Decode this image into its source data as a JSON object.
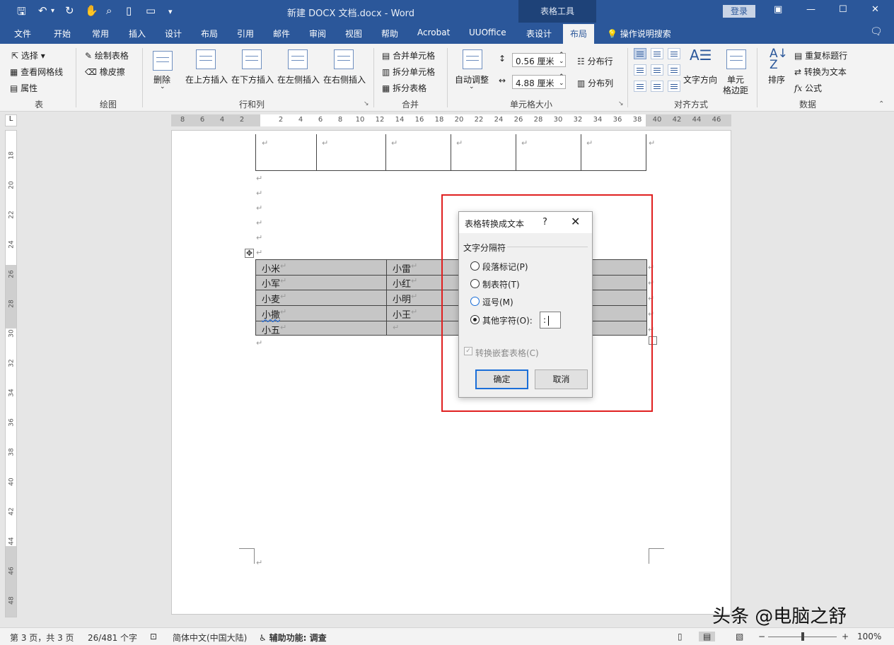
{
  "window": {
    "title": "新建 DOCX 文档.docx  -  Word",
    "context_tab_group": "表格工具",
    "login": "登录"
  },
  "tabs": [
    "文件",
    "开始",
    "常用",
    "插入",
    "设计",
    "布局",
    "引用",
    "邮件",
    "审阅",
    "视图",
    "帮助",
    "Acrobat",
    "UUOffice",
    "表设计",
    "布局"
  ],
  "active_tab_index": 14,
  "tell_me": "操作说明搜索",
  "ribbon": {
    "table": {
      "select": "选择",
      "view_gridlines": "查看网格线",
      "properties": "属性",
      "label": "表"
    },
    "draw": {
      "draw_table": "绘制表格",
      "eraser": "橡皮擦",
      "label": "绘图"
    },
    "rows_cols": {
      "delete": "删除",
      "insert_above": "在上方插入",
      "insert_below": "在下方插入",
      "insert_left": "在左侧插入",
      "insert_right": "在右侧插入",
      "label": "行和列"
    },
    "merge": {
      "merge_cells": "合并单元格",
      "split_cells": "拆分单元格",
      "split_table": "拆分表格",
      "label": "合并"
    },
    "cell_size": {
      "autofit": "自动调整",
      "height": "0.56 厘米",
      "width": "4.88 厘米",
      "dist_rows": "分布行",
      "dist_cols": "分布列",
      "label": "单元格大小"
    },
    "alignment": {
      "text_direction": "文字方向",
      "cell_margins_1": "单元",
      "cell_margins_2": "格边距",
      "label": "对齐方式"
    },
    "data": {
      "sort": "排序",
      "repeat_header": "重复标题行",
      "convert_to_text": "转换为文本",
      "formula": "公式",
      "label": "数据"
    }
  },
  "ruler": {
    "h_numbers": [
      "8",
      "6",
      "4",
      "2",
      "2",
      "4",
      "6",
      "8",
      "10",
      "12",
      "14",
      "16",
      "18",
      "20",
      "22",
      "24",
      "26",
      "28",
      "30",
      "32",
      "34",
      "36",
      "38",
      "40",
      "42",
      "44",
      "46"
    ],
    "v_numbers": [
      "18",
      "20",
      "22",
      "24",
      "26",
      "28",
      "30",
      "32",
      "34",
      "36",
      "38",
      "40",
      "42",
      "44",
      "46",
      "48"
    ],
    "corner": "L"
  },
  "document": {
    "selected_table": [
      [
        "小米",
        "小雷"
      ],
      [
        "小军",
        "小红"
      ],
      [
        "小麦",
        "小明"
      ],
      [
        "小撒",
        "小王"
      ],
      [
        "小五",
        ""
      ]
    ],
    "paragraph_mark": "↵"
  },
  "dialog": {
    "title": "表格转换成文本",
    "help": "?",
    "close": "✕",
    "group_label": "文字分隔符",
    "options": [
      "段落标记(P)",
      "制表符(T)",
      "逗号(M)",
      "其他字符(O):"
    ],
    "selected_option_index": 3,
    "other_char": ":",
    "nested_tables": "转换嵌套表格(C)",
    "ok": "确定",
    "cancel": "取消"
  },
  "statusbar": {
    "page": "第 3 页，共 3 页",
    "words": "26/481 个字",
    "language": "简体中文(中国大陆)",
    "accessibility": "辅助功能: 调查",
    "zoom": "100%"
  },
  "watermark": "头条 @电脑之舒"
}
